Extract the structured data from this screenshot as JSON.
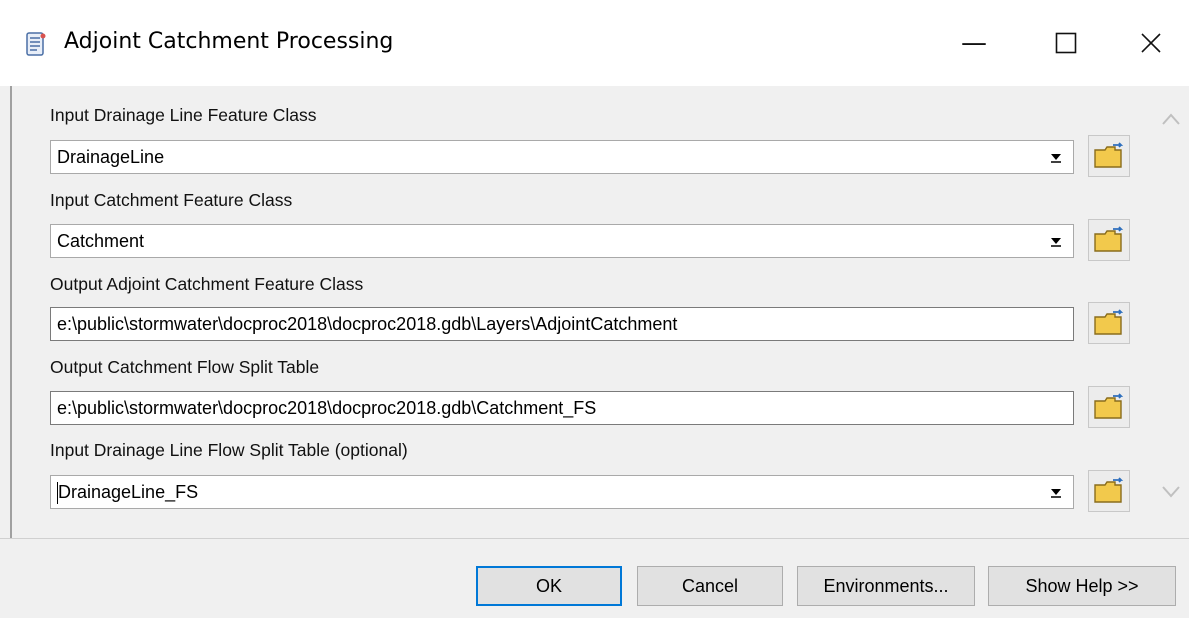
{
  "window": {
    "title": "Adjoint Catchment Processing",
    "minimize_glyph": "—",
    "maximize_glyph": "☐",
    "close_glyph": "✕",
    "icon": "script-tool-icon"
  },
  "params": [
    {
      "label": "Input Drainage Line Feature Class",
      "value": "DrainageLine",
      "type": "combo"
    },
    {
      "label": "Input Catchment Feature Class",
      "value": "Catchment",
      "type": "combo"
    },
    {
      "label": "Output Adjoint Catchment Feature Class",
      "value": "e:\\public\\stormwater\\docproc2018\\docproc2018.gdb\\Layers\\AdjointCatchment",
      "type": "text"
    },
    {
      "label": "Output Catchment Flow Split Table",
      "value": "e:\\public\\stormwater\\docproc2018\\docproc2018.gdb\\Catchment_FS",
      "type": "text"
    },
    {
      "label": "Input Drainage Line Flow Split Table (optional)",
      "value": "DrainageLine_FS",
      "type": "combo"
    }
  ],
  "buttons": {
    "ok": "OK",
    "cancel": "Cancel",
    "environments": "Environments...",
    "help": "Show Help >>"
  },
  "colors": {
    "accent": "#0078d7",
    "folder": "#f2c94c"
  }
}
